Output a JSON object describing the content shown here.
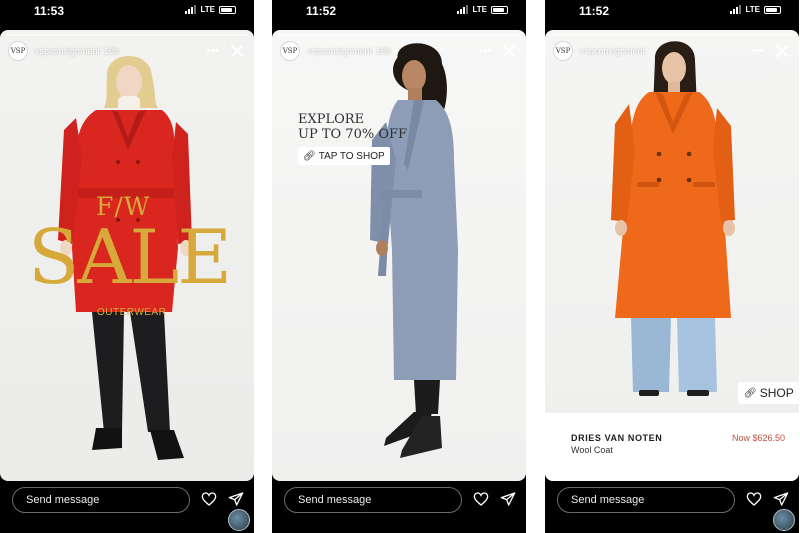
{
  "stories": [
    {
      "status_time": "11:53",
      "network": "LTE",
      "username": "vspconsignment",
      "time_ago": "10h",
      "avatar_text": "VSP",
      "overlay": {
        "line1": "F/W",
        "line2": "SALE",
        "line3": "OUTERWEAR"
      },
      "coat_color": "#d9261f",
      "send_placeholder": "Send message"
    },
    {
      "status_time": "11:52",
      "network": "LTE",
      "username": "vspconsignment",
      "time_ago": "10h",
      "avatar_text": "VSP",
      "overlay": {
        "line1": "EXPLORE",
        "line2": "UP TO 70% OFF",
        "cta": "TAP TO SHOP"
      },
      "coat_color": "#8d9db7",
      "send_placeholder": "Send message"
    },
    {
      "status_time": "11:52",
      "network": "LTE",
      "username": "vspconsignment",
      "time_ago": "",
      "avatar_text": "VSP",
      "sticker": "SHOP",
      "product": {
        "brand": "DRIES VAN NOTEN",
        "name": "Wool Coat",
        "price": "Now $626.50"
      },
      "coat_color": "#ee6a1a",
      "send_placeholder": "Send message"
    }
  ],
  "icons": {
    "more": "more-icon",
    "close": "close-icon",
    "like": "heart-icon",
    "share": "send-icon",
    "link": "link-icon"
  },
  "colors": {
    "sale_gold": "#d6a93a",
    "price_red": "#c5513f"
  }
}
